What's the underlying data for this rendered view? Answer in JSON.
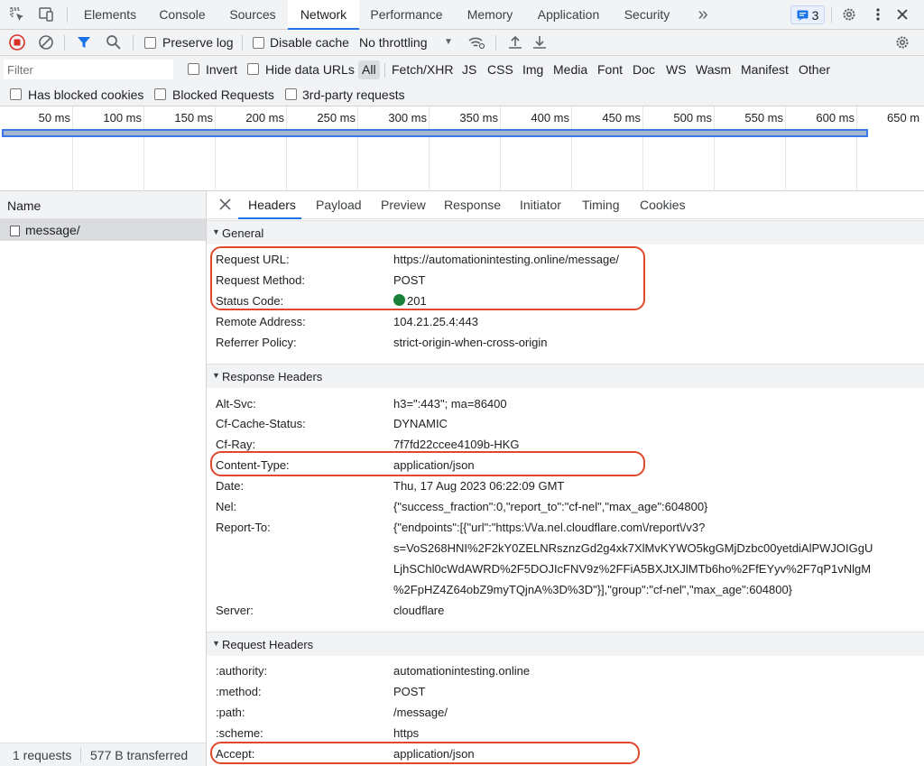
{
  "tabs": {
    "items": [
      "Elements",
      "Console",
      "Sources",
      "Network",
      "Performance",
      "Memory",
      "Application",
      "Security"
    ],
    "more": "»",
    "issues_count": "3"
  },
  "toolbar": {
    "preserve_log": "Preserve log",
    "disable_cache": "Disable cache",
    "throttling": "No throttling"
  },
  "filter": {
    "placeholder": "Filter",
    "invert": "Invert",
    "hide_data_urls": "Hide data URLs",
    "types": [
      "All",
      "Fetch/XHR",
      "JS",
      "CSS",
      "Img",
      "Media",
      "Font",
      "Doc",
      "WS",
      "Wasm",
      "Manifest",
      "Other"
    ],
    "has_blocked_cookies": "Has blocked cookies",
    "blocked_requests": "Blocked Requests",
    "third_party": "3rd-party requests"
  },
  "timeline": {
    "ticks": [
      "50 ms",
      "100 ms",
      "150 ms",
      "200 ms",
      "250 ms",
      "300 ms",
      "350 ms",
      "400 ms",
      "450 ms",
      "500 ms",
      "550 ms",
      "600 ms",
      "650 m"
    ]
  },
  "requests": {
    "column_name": "Name",
    "items": [
      "message/"
    ],
    "status_count": "1 requests",
    "status_transferred": "577 B transferred"
  },
  "details": {
    "tabs": [
      "Headers",
      "Payload",
      "Preview",
      "Response",
      "Initiator",
      "Timing",
      "Cookies"
    ],
    "general": {
      "title": "General",
      "rows": [
        {
          "k": "Request URL:",
          "v": "https://automationintesting.online/message/"
        },
        {
          "k": "Request Method:",
          "v": "POST"
        },
        {
          "k": "Status Code:",
          "v": "201"
        },
        {
          "k": "Remote Address:",
          "v": "104.21.25.4:443"
        },
        {
          "k": "Referrer Policy:",
          "v": "strict-origin-when-cross-origin"
        }
      ]
    },
    "response_headers": {
      "title": "Response Headers",
      "rows": [
        {
          "k": "Alt-Svc:",
          "v": "h3=\":443\"; ma=86400"
        },
        {
          "k": "Cf-Cache-Status:",
          "v": "DYNAMIC"
        },
        {
          "k": "Cf-Ray:",
          "v": "7f7fd22ccee4109b-HKG"
        },
        {
          "k": "Content-Type:",
          "v": "application/json"
        },
        {
          "k": "Date:",
          "v": "Thu, 17 Aug 2023 06:22:09 GMT"
        },
        {
          "k": "Nel:",
          "v": "{\"success_fraction\":0,\"report_to\":\"cf-nel\",\"max_age\":604800}"
        },
        {
          "k": "Report-To:",
          "v": "{\"endpoints\":[{\"url\":\"https:\\/\\/a.nel.cloudflare.com\\/report\\/v3?"
        },
        {
          "k": "",
          "v": "s=VoS268HNI%2F2kY0ZELNRsznzGd2g4xk7XlMvKYWO5kgGMjDzbc00yetdiAlPWJOIGgU"
        },
        {
          "k": "",
          "v": "LjhSChl0cWdAWRD%2F5DOJIcFNV9z%2FFiA5BXJtXJlMTb6ho%2FfEYyv%2F7qP1vNlgM"
        },
        {
          "k": "",
          "v": "%2FpHZ4Z64obZ9myTQjnA%3D%3D\"}],\"group\":\"cf-nel\",\"max_age\":604800}"
        },
        {
          "k": "Server:",
          "v": "cloudflare"
        }
      ]
    },
    "request_headers": {
      "title": "Request Headers",
      "rows": [
        {
          "k": ":authority:",
          "v": "automationintesting.online"
        },
        {
          "k": ":method:",
          "v": "POST"
        },
        {
          "k": ":path:",
          "v": "/message/"
        },
        {
          "k": ":scheme:",
          "v": "https"
        },
        {
          "k": "Accept:",
          "v": "application/json"
        }
      ]
    }
  },
  "colors": {
    "accent": "#1a73e8",
    "annotation": "#e0482e",
    "status_ok": "#188038",
    "record": "#d93025"
  }
}
